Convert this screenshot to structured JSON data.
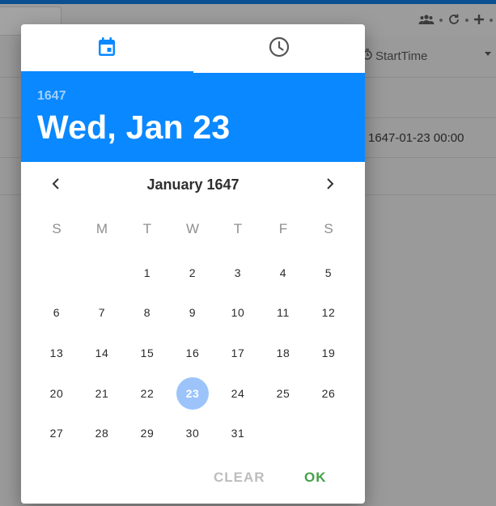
{
  "background": {
    "column_header": "StartTime",
    "cell_value": "1647-01-23 00:00"
  },
  "dialog": {
    "tabs": [
      {
        "icon": "calendar-icon",
        "active": true
      },
      {
        "icon": "clock-icon",
        "active": false
      }
    ],
    "header": {
      "year": "1647",
      "date": "Wed, Jan 23"
    },
    "month_label": "January 1647",
    "weekdays": [
      "S",
      "M",
      "T",
      "W",
      "T",
      "F",
      "S"
    ],
    "leading_blanks": 2,
    "days": [
      "1",
      "2",
      "3",
      "4",
      "5",
      "6",
      "7",
      "8",
      "9",
      "10",
      "11",
      "12",
      "13",
      "14",
      "15",
      "16",
      "17",
      "18",
      "19",
      "20",
      "21",
      "22",
      "23",
      "24",
      "25",
      "26",
      "27",
      "28",
      "29",
      "30",
      "31"
    ],
    "selected_day": "23",
    "actions": {
      "clear_label": "CLEAR",
      "ok_label": "OK"
    }
  },
  "colors": {
    "primary": "#0a88ff",
    "selected_day": "#9cc4fb",
    "ok": "#43a047",
    "clear": "#bdbdbd"
  }
}
